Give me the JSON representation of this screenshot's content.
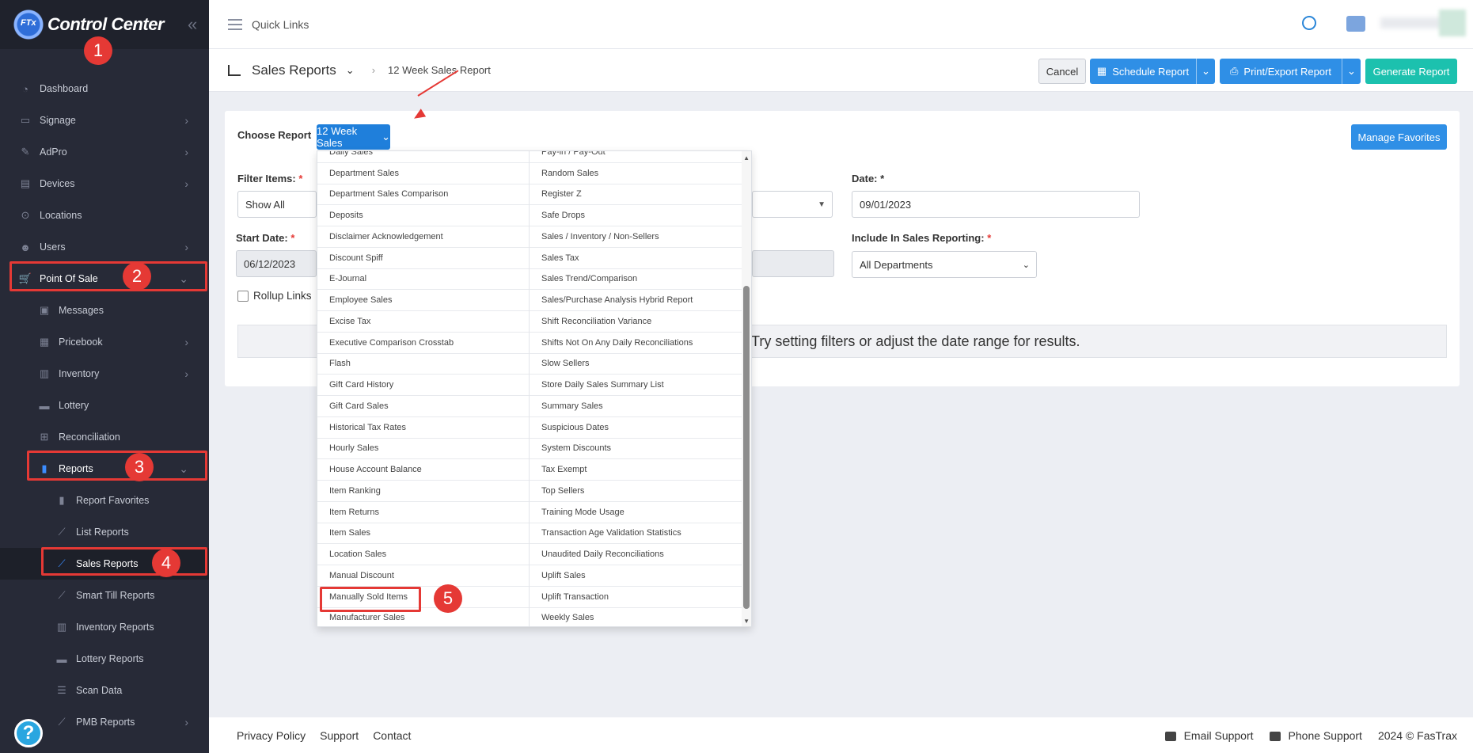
{
  "app": {
    "title": "Control Center",
    "logo_text": "FTx"
  },
  "sidebar": {
    "items": [
      {
        "label": "Dashboard"
      },
      {
        "label": "Signage"
      },
      {
        "label": "AdPro"
      },
      {
        "label": "Devices"
      },
      {
        "label": "Locations"
      },
      {
        "label": "Users"
      },
      {
        "label": "Point Of Sale"
      },
      {
        "label": "Messages"
      },
      {
        "label": "Pricebook"
      },
      {
        "label": "Inventory"
      },
      {
        "label": "Lottery"
      },
      {
        "label": "Reconciliation"
      },
      {
        "label": "Reports"
      },
      {
        "label": "Report Favorites"
      },
      {
        "label": "List Reports"
      },
      {
        "label": "Sales Reports"
      },
      {
        "label": "Smart Till Reports"
      },
      {
        "label": "Inventory Reports"
      },
      {
        "label": "Lottery Reports"
      },
      {
        "label": "Scan Data"
      },
      {
        "label": "PMB Reports"
      }
    ],
    "help": "?"
  },
  "topbar": {
    "quick_links": "Quick Links"
  },
  "header": {
    "title": "Sales Reports",
    "breadcrumb": "12 Week Sales Report"
  },
  "buttons": {
    "cancel": "Cancel",
    "schedule": "Schedule Report",
    "print": "Print/Export Report",
    "generate": "Generate Report",
    "manage": "Manage Favorites"
  },
  "form": {
    "choose_report_label": "Choose Report",
    "choose_report_value": "12 Week Sales",
    "filter_items_label": "Filter Items:",
    "filter_items_value": "Show All",
    "date_label": "Date:",
    "date_value": "09/01/2023",
    "start_date_label": "Start Date:",
    "start_date_value": "06/12/2023",
    "include_label": "Include In Sales Reporting:",
    "include_value": "All Departments",
    "rollup_label": "Rollup Links",
    "required": "*",
    "message": "Try setting filters or adjust the date range for results."
  },
  "dropdown": {
    "left": [
      "Daily Sales",
      "Department Sales",
      "Department Sales Comparison",
      "Deposits",
      "Disclaimer Acknowledgement",
      "Discount Spiff",
      "E-Journal",
      "Employee Sales",
      "Excise Tax",
      "Executive Comparison Crosstab",
      "Flash",
      "Gift Card History",
      "Gift Card Sales",
      "Historical Tax Rates",
      "Hourly Sales",
      "House Account Balance",
      "Item Ranking",
      "Item Returns",
      "Item Sales",
      "Location Sales",
      "Manual Discount",
      "Manually Sold Items",
      "Manufacturer Sales"
    ],
    "right": [
      "Pay-in / Pay-Out",
      "Random Sales",
      "Register Z",
      "Safe Drops",
      "Sales / Inventory / Non-Sellers",
      "Sales Tax",
      "Sales Trend/Comparison",
      "Sales/Purchase Analysis Hybrid Report",
      "Shift Reconciliation Variance",
      "Shifts Not On Any Daily Reconciliations",
      "Slow Sellers",
      "Store Daily Sales Summary List",
      "Summary Sales",
      "Suspicious Dates",
      "System Discounts",
      "Tax Exempt",
      "Top Sellers",
      "Training Mode Usage",
      "Transaction Age Validation Statistics",
      "Unaudited Daily Reconciliations",
      "Uplift Sales",
      "Uplift Transaction",
      "Weekly Sales"
    ]
  },
  "annotations": [
    "1",
    "2",
    "3",
    "4",
    "5"
  ],
  "footer": {
    "privacy": "Privacy Policy",
    "support": "Support",
    "contact": "Contact",
    "email_support": "Email Support",
    "phone_support": "Phone Support",
    "copyright": "2024 © FasTrax"
  },
  "colors": {
    "sidebar_bg": "#272a37",
    "accent": "#2f8fe6",
    "generate": "#1cc1ae",
    "highlight": "#e53935"
  }
}
